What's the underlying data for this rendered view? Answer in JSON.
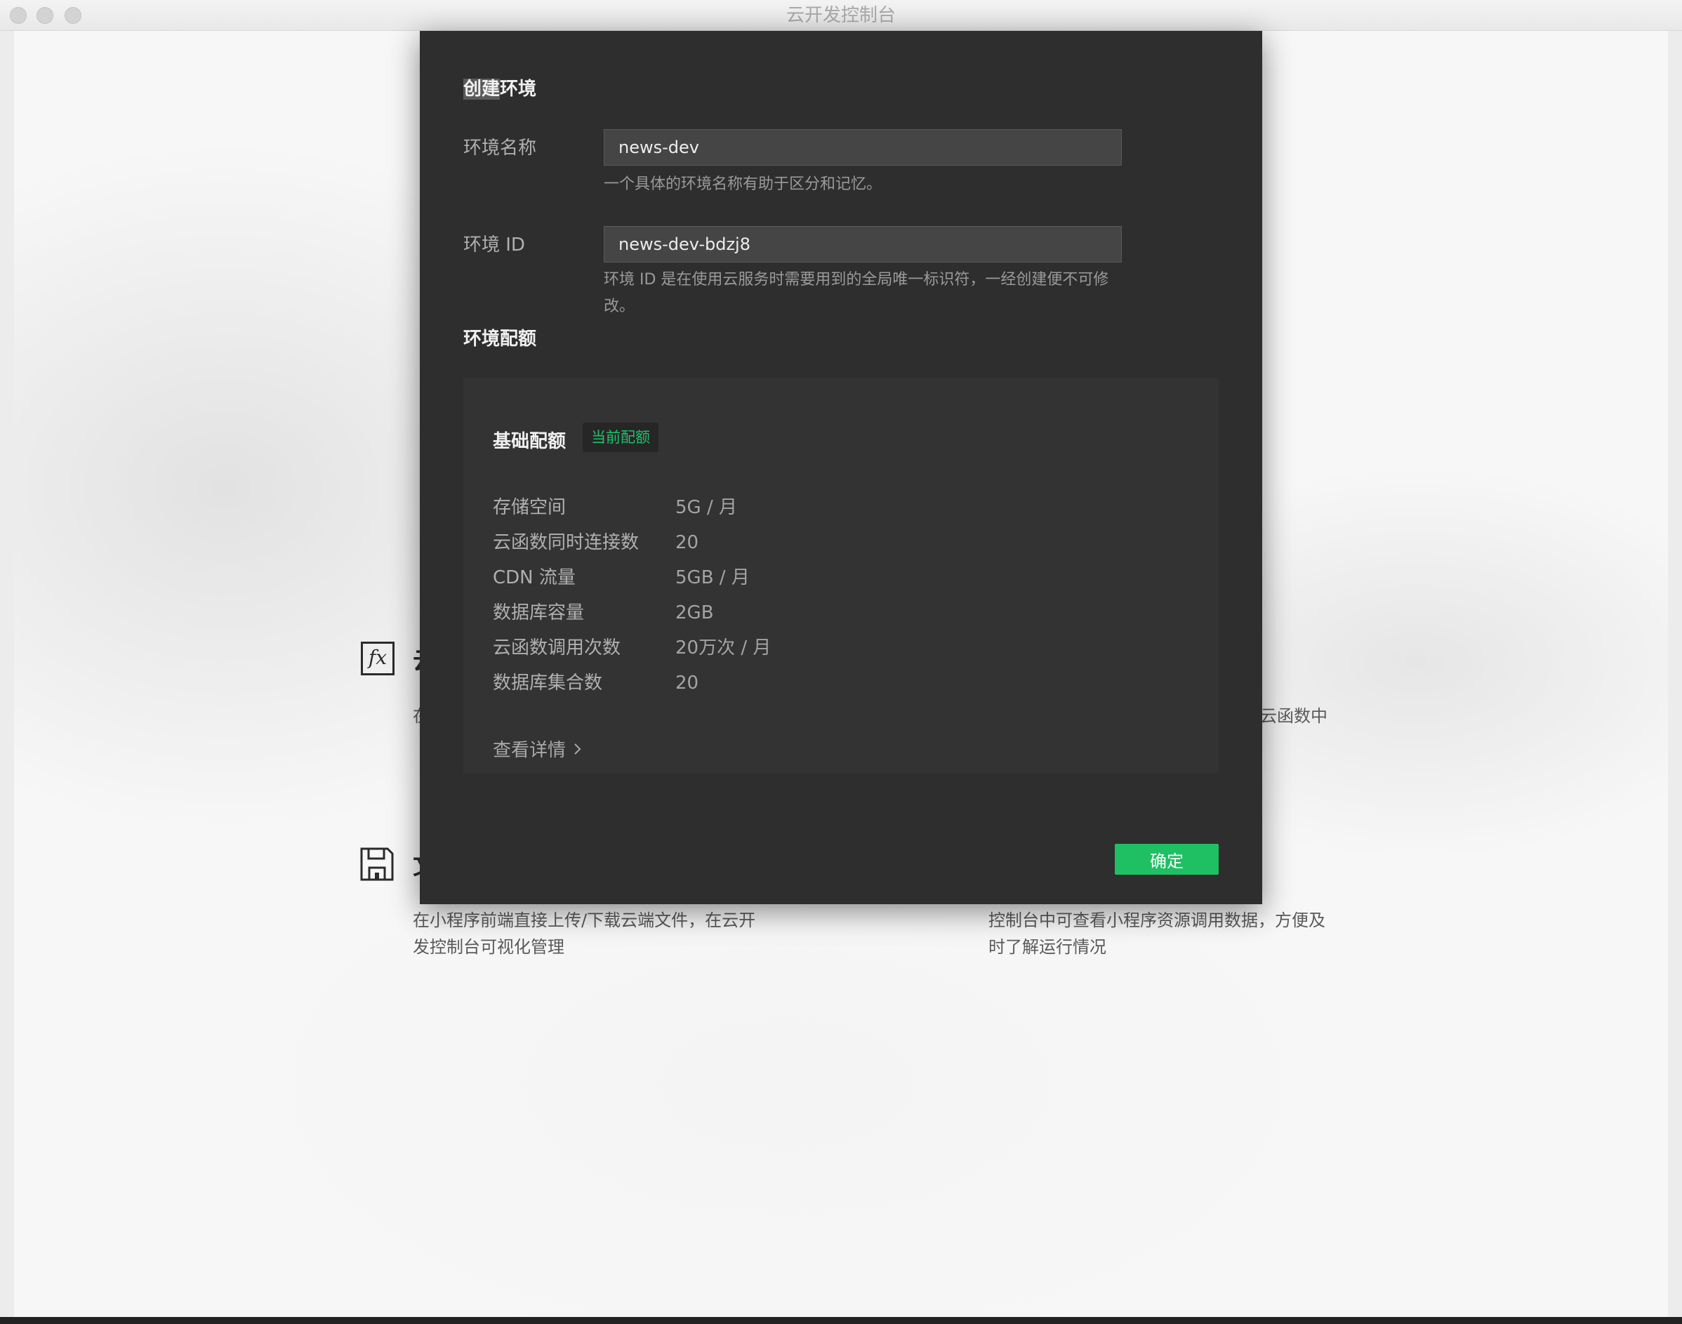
{
  "window": {
    "title": "云开发控制台"
  },
  "background": {
    "left_desc_line1": "在小程序前端直接上传/下载云端文件，在云开",
    "left_desc_line2": "发控制台可视化管理",
    "right_desc_line1": "控制台中可查看小程序资源调用数据，方便及",
    "right_desc_line2": "时了解运行情况",
    "right_frag": "云函数中",
    "left_frag": "在"
  },
  "dialog": {
    "title_highlight": "创建",
    "title_rest": "环境",
    "env_name": {
      "label": "环境名称",
      "value": "news-dev",
      "hint": "一个具体的环境名称有助于区分和记忆。"
    },
    "env_id": {
      "label": "环境 ID",
      "value": "news-dev-bdzj8",
      "hint_line1": "环境 ID 是在使用云服务时需要用到的全局唯一标识符，一经创建便不可修",
      "hint_line2": "改。"
    },
    "quota_section_title": "环境配额",
    "quota": {
      "name": "基础配额",
      "badge": "当前配额",
      "rows": [
        {
          "key": "存储空间",
          "value": "5G / 月"
        },
        {
          "key": "云函数同时连接数",
          "value": "20"
        },
        {
          "key": "CDN 流量",
          "value": "5GB / 月"
        },
        {
          "key": "数据库容量",
          "value": "2GB"
        },
        {
          "key": "云函数调用次数",
          "value": "20万次 / 月"
        },
        {
          "key": "数据库集合数",
          "value": "20"
        }
      ],
      "details_link": "查看详情"
    },
    "confirm_label": "确定"
  },
  "colors": {
    "accent": "#1fbf63",
    "badge_text": "#1fc16b",
    "dialog_bg": "#2e2e2e"
  },
  "icons": [
    "fx-icon",
    "save-icon",
    "chevron-right-icon"
  ]
}
